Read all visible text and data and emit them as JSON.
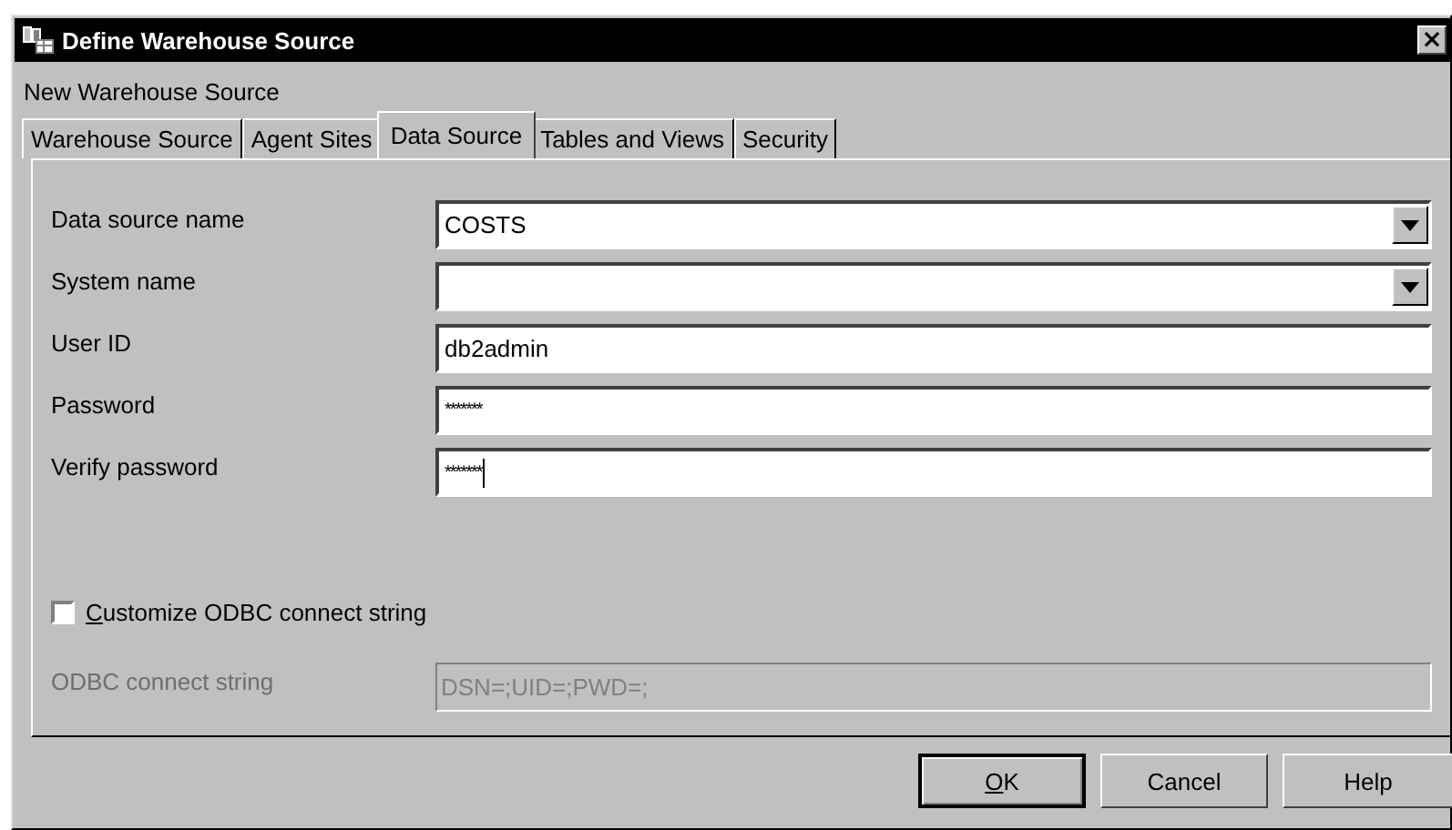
{
  "window": {
    "title": "Define Warehouse Source",
    "close": "×"
  },
  "subtitle": "New Warehouse Source",
  "tabs": [
    {
      "label": "Warehouse Source",
      "selected": false
    },
    {
      "label": "Agent Sites",
      "selected": false
    },
    {
      "label": "Data Source",
      "selected": true
    },
    {
      "label": "Tables and Views",
      "selected": false
    },
    {
      "label": "Security",
      "selected": false
    }
  ],
  "fields": [
    {
      "label": "Data source name",
      "kind": "combo",
      "value": "COSTS",
      "focused": false
    },
    {
      "label": "System name",
      "kind": "combo",
      "focused": false
    },
    {
      "label": "User ID",
      "kind": "text",
      "value": "db2admin",
      "focused": false
    },
    {
      "label": "Password",
      "kind": "password",
      "value": "*******",
      "focused": false
    },
    {
      "label": "Verify password",
      "kind": "password",
      "value": "*******",
      "focused": true
    }
  ],
  "checkbox": {
    "label": "Customize ODBC connect string",
    "checked": false,
    "first_letter_underlined": true
  },
  "odbc": {
    "label": "ODBC connect string",
    "value": "DSN=;UID=;PWD=;",
    "disabled": true
  },
  "buttons": [
    {
      "label": "OK",
      "default": true,
      "first_letter_underlined": true
    },
    {
      "label": "Cancel",
      "default": false,
      "first_letter_underlined": false
    },
    {
      "label": "Help",
      "default": false,
      "first_letter_underlined": false
    }
  ]
}
